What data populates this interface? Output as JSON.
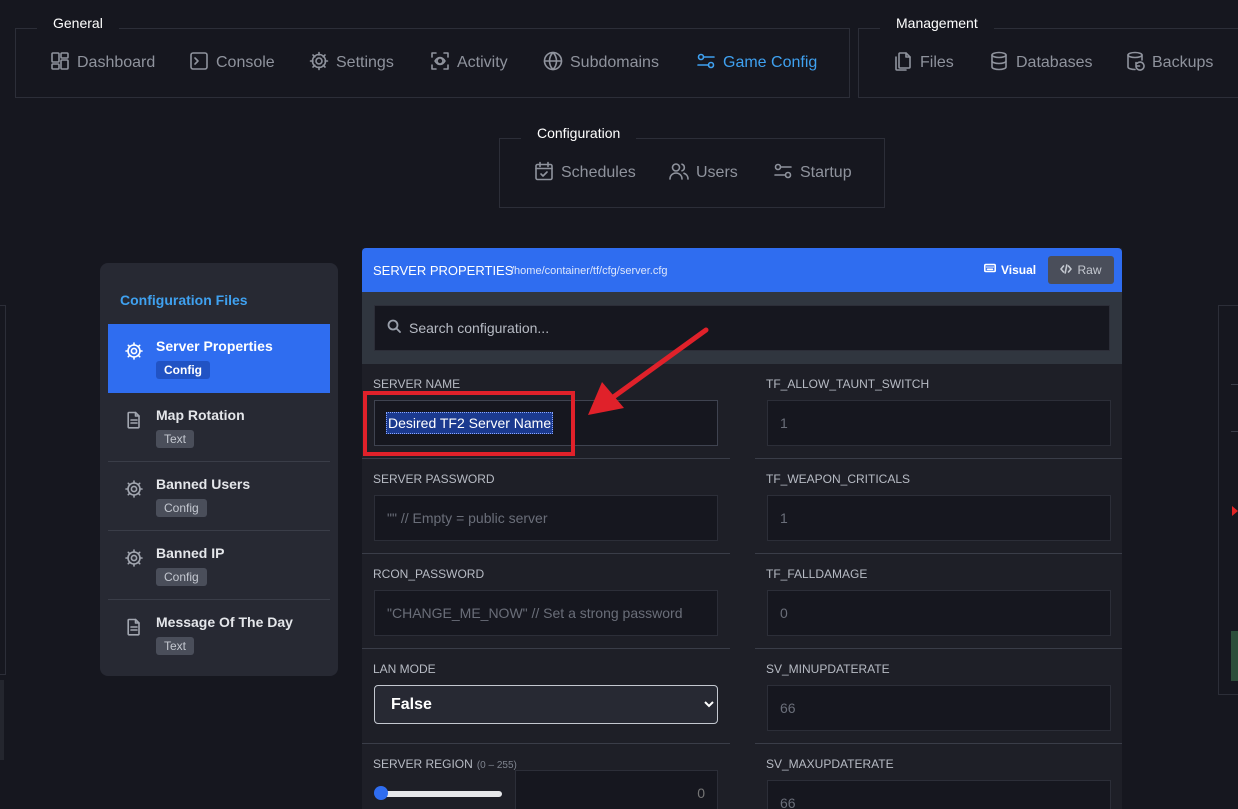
{
  "top_nav": {
    "general": {
      "label": "General",
      "items": [
        {
          "label": "Dashboard",
          "icon": "dashboard-icon"
        },
        {
          "label": "Console",
          "icon": "console-icon"
        },
        {
          "label": "Settings",
          "icon": "gear-icon"
        },
        {
          "label": "Activity",
          "icon": "activity-icon"
        },
        {
          "label": "Subdomains",
          "icon": "globe-icon"
        },
        {
          "label": "Game Config",
          "icon": "sliders-icon",
          "active": true
        }
      ]
    },
    "management": {
      "label": "Management",
      "items": [
        {
          "label": "Files",
          "icon": "files-icon"
        },
        {
          "label": "Databases",
          "icon": "database-icon"
        },
        {
          "label": "Backups",
          "icon": "backup-icon"
        }
      ]
    },
    "configuration": {
      "label": "Configuration",
      "items": [
        {
          "label": "Schedules",
          "icon": "calendar-icon"
        },
        {
          "label": "Users",
          "icon": "users-icon"
        },
        {
          "label": "Startup",
          "icon": "sliders-icon"
        }
      ]
    }
  },
  "sidebar": {
    "title": "Configuration Files",
    "items": [
      {
        "name": "Server Properties",
        "tag": "Config",
        "icon": "gear-icon",
        "active": true
      },
      {
        "name": "Map Rotation",
        "tag": "Text",
        "icon": "file-icon"
      },
      {
        "name": "Banned Users",
        "tag": "Config",
        "icon": "gear-icon"
      },
      {
        "name": "Banned IP",
        "tag": "Config",
        "icon": "gear-icon"
      },
      {
        "name": "Message Of The Day",
        "tag": "Text",
        "icon": "file-icon"
      }
    ]
  },
  "panel": {
    "title": "SERVER PROPERTIES",
    "path": "/home/container/tf/cfg/server.cfg",
    "visual_label": "Visual",
    "raw_label": "Raw",
    "search_placeholder": "Search configuration...",
    "left_fields": {
      "server_name": {
        "label": "SERVER NAME",
        "value": "Desired TF2 Server Name"
      },
      "server_password": {
        "label": "SERVER PASSWORD",
        "placeholder": "\"\" // Empty = public server"
      },
      "rcon_password": {
        "label": "RCON_PASSWORD",
        "placeholder": "\"CHANGE_ME_NOW\" // Set a strong password"
      },
      "lan_mode": {
        "label": "LAN MODE",
        "value": "False"
      },
      "server_region": {
        "label": "SERVER REGION",
        "range": "(0 – 255)",
        "value": "0",
        "level": 0
      }
    },
    "right_fields": {
      "taunt_switch": {
        "label": "TF_ALLOW_TAUNT_SWITCH",
        "placeholder": "1"
      },
      "weapon_criticals": {
        "label": "TF_WEAPON_CRITICALS",
        "placeholder": "1"
      },
      "falldamage": {
        "label": "TF_FALLDAMAGE",
        "placeholder": "0"
      },
      "minupdaterate": {
        "label": "SV_MINUPDATERATE",
        "placeholder": "66"
      },
      "maxupdaterate": {
        "label": "SV_MAXUPDATERATE",
        "placeholder": "66"
      }
    }
  },
  "colors": {
    "accent": "#2f6df0",
    "active_nav": "#3fa1f0",
    "annotation": "#e0212a"
  }
}
